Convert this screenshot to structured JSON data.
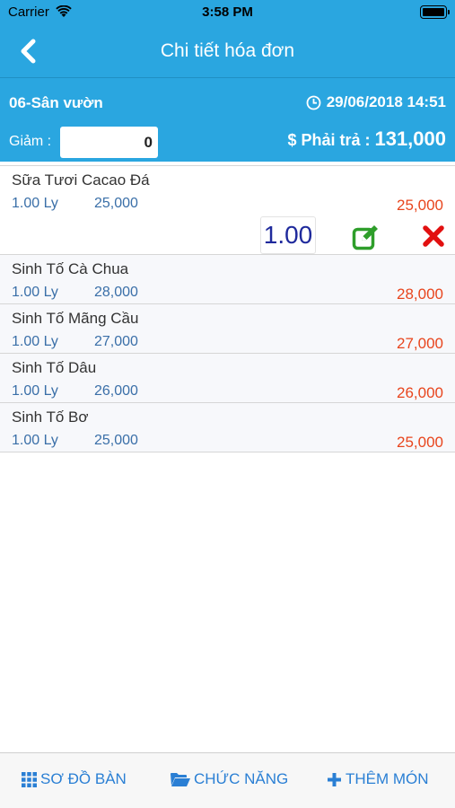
{
  "status_bar": {
    "carrier": "Carrier",
    "time": "3:58 PM"
  },
  "nav": {
    "title": "Chi tiết hóa đơn"
  },
  "info": {
    "table_name": "06-Sân vườn",
    "datetime": "29/06/2018 14:51",
    "discount_label": "Giảm :",
    "discount_value": "0",
    "total_label": "$ Phải trả :",
    "total_value": "131,000"
  },
  "items": [
    {
      "name": "Sữa Tươi Cacao Đá",
      "qty": "1.00 Ly",
      "price": "25,000",
      "amount": "25,000",
      "edit_qty": "1.00"
    },
    {
      "name": "Sinh Tố Cà Chua",
      "qty": "1.00 Ly",
      "price": "28,000",
      "amount": "28,000"
    },
    {
      "name": "Sinh Tố Mãng Cầu",
      "qty": "1.00 Ly",
      "price": "27,000",
      "amount": "27,000"
    },
    {
      "name": "Sinh Tố Dâu",
      "qty": "1.00 Ly",
      "price": "26,000",
      "amount": "26,000"
    },
    {
      "name": "Sinh Tố Bơ",
      "qty": "1.00 Ly",
      "price": "25,000",
      "amount": "25,000"
    }
  ],
  "bottom": {
    "map_label": "SƠ ĐỒ BÀN",
    "func_label": "CHỨC NĂNG",
    "add_label": "THÊM MÓN"
  },
  "colors": {
    "header_bg": "#2aa6e0",
    "amount": "#e8451d",
    "qty_price": "#3a6fa8",
    "edit_icon": "#2e9e2a",
    "delete_icon": "#e21010",
    "bottom_link": "#2a7fd4"
  },
  "icons": {
    "back": "chevron-left-icon",
    "clock": "clock-icon",
    "edit": "edit-square-icon",
    "delete": "close-x-icon",
    "map": "grid-icon",
    "func": "folder-open-icon",
    "add": "plus-icon"
  }
}
